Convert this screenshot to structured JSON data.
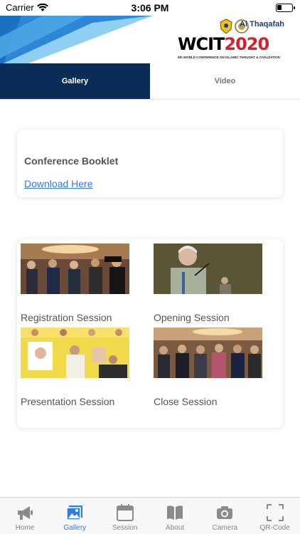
{
  "status_bar": {
    "carrier": "Carrier",
    "time": "3:06 PM",
    "battery_level": 0.3
  },
  "banner": {
    "logo_text_wc": "WC",
    "logo_text_it": "IT",
    "logo_text_year": "2020",
    "logo_brand": "Al Thaqafah",
    "logo_caption": "6th WORLD CONFERENCE ON ISLAMIC THOUGHT & CIVILIZATION",
    "colors": {
      "stripe_dark": "#1d6fc4",
      "stripe_light": "#8fd0f2",
      "logo_red": "#d4202a",
      "logo_black": "#000000"
    }
  },
  "tabs": [
    {
      "label": "Gallery",
      "active": true
    },
    {
      "label": "Video",
      "active": false
    }
  ],
  "booklet": {
    "title": "Conference Booklet",
    "link": "Download Here"
  },
  "gallery": [
    {
      "caption": "Registration Session",
      "icon": "photo-thumbnail"
    },
    {
      "caption": "Opening Session",
      "icon": "photo-thumbnail"
    },
    {
      "caption": "Presentation Session",
      "icon": "photo-thumbnail"
    },
    {
      "caption": "Close Session",
      "icon": "photo-thumbnail"
    }
  ],
  "tabbar": [
    {
      "label": "Home",
      "icon": "megaphone-icon",
      "active": false
    },
    {
      "label": "Gallery",
      "icon": "gallery-icon",
      "active": true
    },
    {
      "label": "Session",
      "icon": "calendar-icon",
      "active": false
    },
    {
      "label": "About",
      "icon": "book-icon",
      "active": false
    },
    {
      "label": "Camera",
      "icon": "camera-icon",
      "active": false
    },
    {
      "label": "QR-Code",
      "icon": "qr-scan-icon",
      "active": false
    }
  ],
  "colors": {
    "tab_active_bg": "#0a2d57",
    "tabbar_active": "#2a7de1",
    "tabbar_inactive": "#888888",
    "link": "#2f7be0"
  }
}
